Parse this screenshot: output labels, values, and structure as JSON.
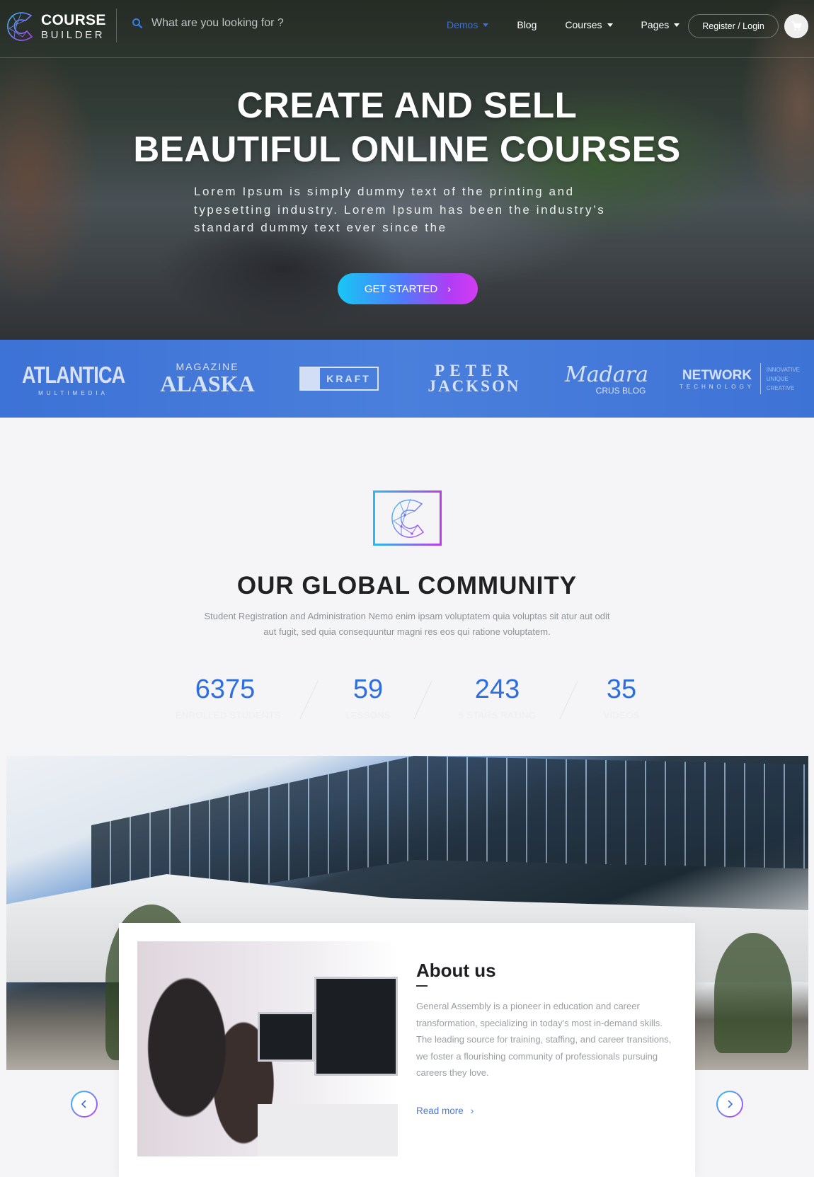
{
  "header": {
    "logo": {
      "line1": "COURSE",
      "line2": "BUILDER"
    },
    "search": {
      "placeholder": "What are you looking for ?",
      "value": "",
      "icon": "search-icon"
    },
    "nav": [
      {
        "label": "Demos",
        "dropdown": true,
        "active": true
      },
      {
        "label": "Blog",
        "dropdown": false,
        "active": false
      },
      {
        "label": "Courses",
        "dropdown": true,
        "active": false
      },
      {
        "label": "Pages",
        "dropdown": true,
        "active": false
      }
    ],
    "login_label": "Register / Login",
    "cart_icon": "shopping-cart-icon"
  },
  "hero": {
    "title_line1": "CREATE AND SELL",
    "title_line2": "BEAUTIFUL ONLINE COURSES",
    "lead": "Lorem Ipsum is simply dummy text of the printing and typesetting industry. Lorem Ipsum has been the industry’s standard dummy text ever since the",
    "cta_label": "GET STARTED",
    "cta_icon": "chevron-right-icon"
  },
  "partners": [
    {
      "name": "ATLANTICA",
      "sub": "MULTIMEDIA"
    },
    {
      "name": "ALASKA",
      "sub": "MAGAZINE"
    },
    {
      "name": "KRAFT"
    },
    {
      "name": "PETER",
      "sub": "JACKSON"
    },
    {
      "name": "Madara",
      "sub": "CRUS BLOG"
    },
    {
      "name": "NETWORK",
      "sub": "TECHNOLOGY",
      "tags": [
        "INNOVATIVE",
        "UNIQUE",
        "CREATIVE"
      ]
    }
  ],
  "community": {
    "title": "OUR GLOBAL COMMUNITY",
    "description": "Student Registration and Administration Nemo enim ipsam voluptatem quia voluptas sit atur aut odit aut fugit, sed quia consequuntur magni res eos qui ratione voluptatem.",
    "stats": [
      {
        "value": "6375",
        "label": "ENROLLED STUDENTS"
      },
      {
        "value": "59",
        "label": "LESSONS"
      },
      {
        "value": "243",
        "label": "5 STARS RATING"
      },
      {
        "value": "35",
        "label": "VIDEOS"
      }
    ]
  },
  "about": {
    "title": "About us",
    "text": "General Assembly is a pioneer in education and career transformation, specializing in today's most in-demand skills. The leading source for training, staffing, and career transitions, we foster a flourishing community of professionals pursuing careers they love.",
    "read_more": "Read more"
  },
  "colors": {
    "accent_blue": "#2d6fe0",
    "gradient_start": "#19c7f5",
    "gradient_end": "#d43cf2",
    "partner_strip": "#4a7fdc"
  }
}
